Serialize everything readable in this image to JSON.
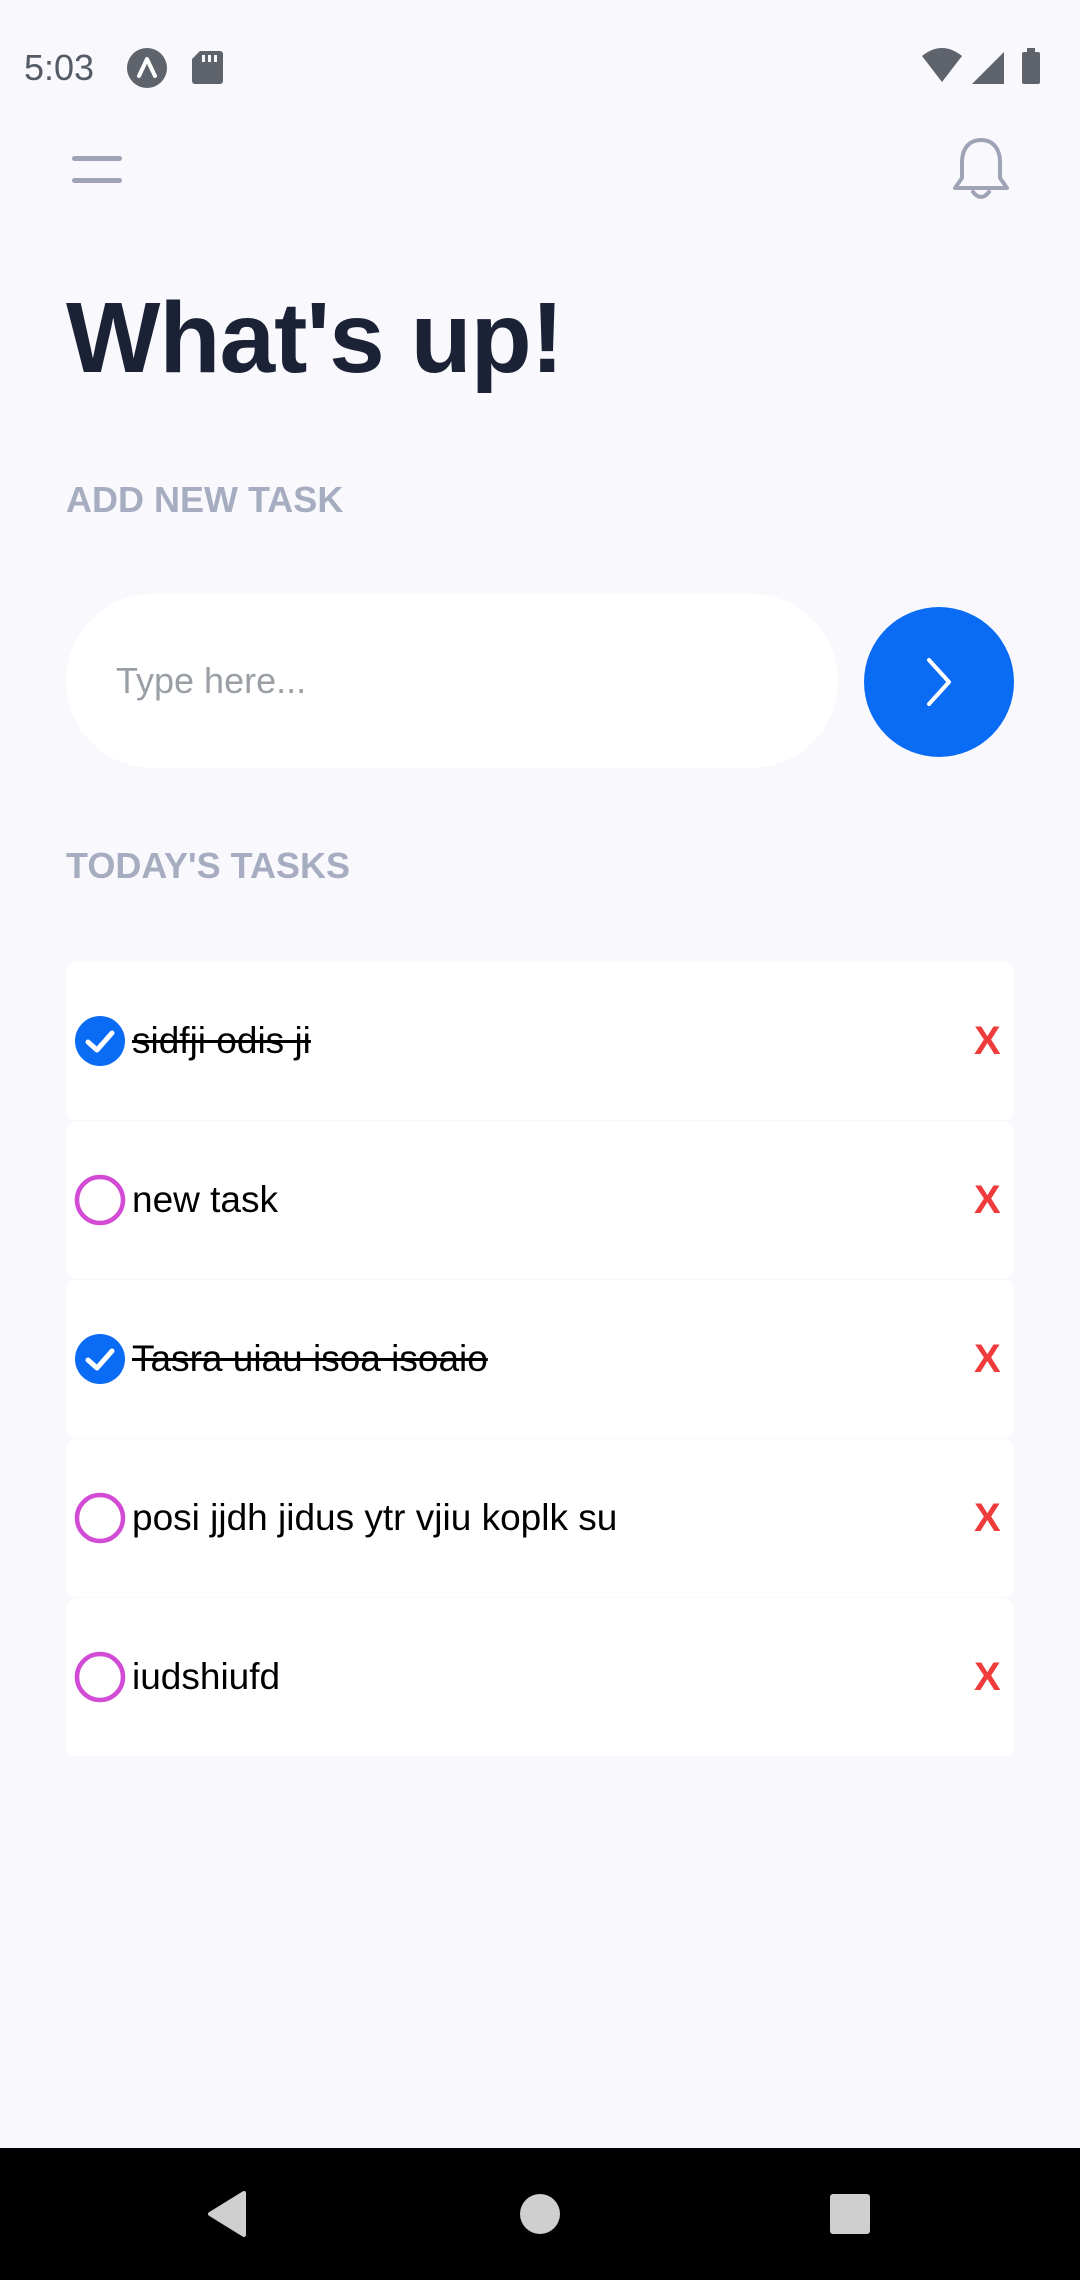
{
  "status_bar": {
    "time": "5:03",
    "icons": [
      "app-notification-icon",
      "sd-card-icon",
      "wifi-icon",
      "cell-signal-icon",
      "battery-icon"
    ]
  },
  "header": {
    "menu_icon": "hamburger-menu-icon",
    "bell_icon": "bell-icon",
    "title": "What's up!"
  },
  "add_task": {
    "section_label": "ADD NEW TASK",
    "input_value": "",
    "input_placeholder": "Type here...",
    "submit_icon": "chevron-right-icon"
  },
  "today": {
    "section_label": "TODAY'S TASKS",
    "tasks": [
      {
        "text": "sidfji odis ji",
        "done": true
      },
      {
        "text": "new task",
        "done": false
      },
      {
        "text": "Tasra uiau isoa isoaio",
        "done": true
      },
      {
        "text": "posi jjdh jidus ytr vjiu koplk su",
        "done": false
      },
      {
        "text": "iudshiufd",
        "done": false
      }
    ],
    "delete_label": "X"
  },
  "nav_bar": {
    "icons": [
      "back-icon",
      "home-icon",
      "recents-icon"
    ]
  },
  "colors": {
    "background": "#F8F8FD",
    "title": "#1B2236",
    "section_label": "#A7ADC0",
    "accent_blue": "#0A6CF5",
    "unchecked_ring": "#D14BD5",
    "delete_red": "#EF3B3B"
  }
}
